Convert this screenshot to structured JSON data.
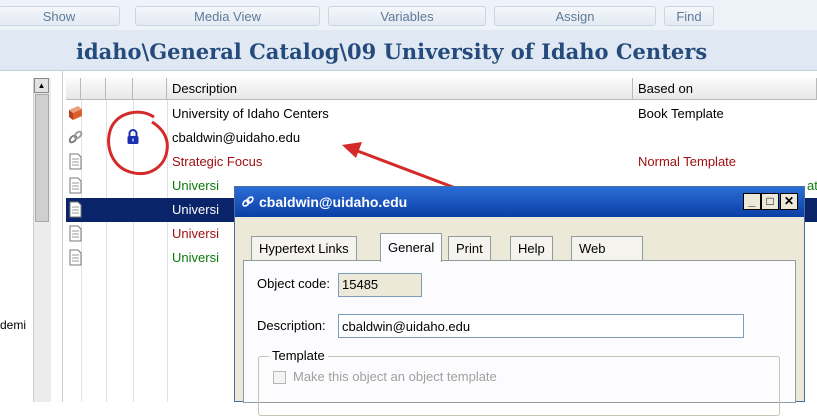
{
  "toolbar": {
    "buttons": [
      {
        "label": "Show"
      },
      {
        "label": "Media View"
      },
      {
        "label": "Variables"
      },
      {
        "label": "Assign"
      },
      {
        "label": "Find"
      }
    ]
  },
  "left_panel": {
    "truncated_text": "demi"
  },
  "path": {
    "title": "idaho\\General Catalog\\09 University of Idaho Centers"
  },
  "table": {
    "columns": [
      "Description",
      "Based on"
    ],
    "rows": [
      {
        "description": "University of Idaho Centers",
        "based_on": "Book Template",
        "icon": "book-icon",
        "color": "#000000",
        "selected": false
      },
      {
        "description": "cbaldwin@uidaho.edu",
        "based_on": "",
        "icon": "link-icon",
        "color": "#000000",
        "selected": false,
        "locked": true
      },
      {
        "description": "Strategic Focus",
        "based_on": "Normal Template",
        "icon": "document-icon",
        "color": "#a01010",
        "selected": false
      },
      {
        "description": "Universi",
        "based_on": "ate",
        "icon": "document-icon",
        "color": "#0a7a0a",
        "selected": false
      },
      {
        "description": "Universi",
        "based_on": "",
        "icon": "document-icon",
        "color": "#ffffff",
        "selected": true
      },
      {
        "description": "Universi",
        "based_on": "",
        "icon": "document-icon",
        "color": "#a01010",
        "selected": false
      },
      {
        "description": "Universi",
        "based_on": "",
        "icon": "document-icon",
        "color": "#0a7a0a",
        "selected": false
      }
    ]
  },
  "dialog": {
    "title": "cbaldwin@uidaho.edu",
    "tabs": [
      {
        "label": "Hypertext Links",
        "active": false
      },
      {
        "label": "General",
        "active": true
      },
      {
        "label": "Print",
        "active": false
      },
      {
        "label": "Help",
        "active": false
      },
      {
        "label": "Web",
        "active": false
      }
    ],
    "object_code_label": "Object code:",
    "object_code_value": "15485",
    "description_label": "Description:",
    "description_value": "cbaldwin@uidaho.edu",
    "template_group_label": "Template",
    "template_checkbox_label": "Make this object an object template",
    "template_checked": false,
    "minimize_symbol": "_",
    "maximize_symbol": "□",
    "close_symbol": "✕"
  },
  "colors": {
    "annotation": "#d42a2a",
    "selection": "#0a246a",
    "title_bar": "#0a3fa5",
    "path_title": "#254b7d"
  }
}
